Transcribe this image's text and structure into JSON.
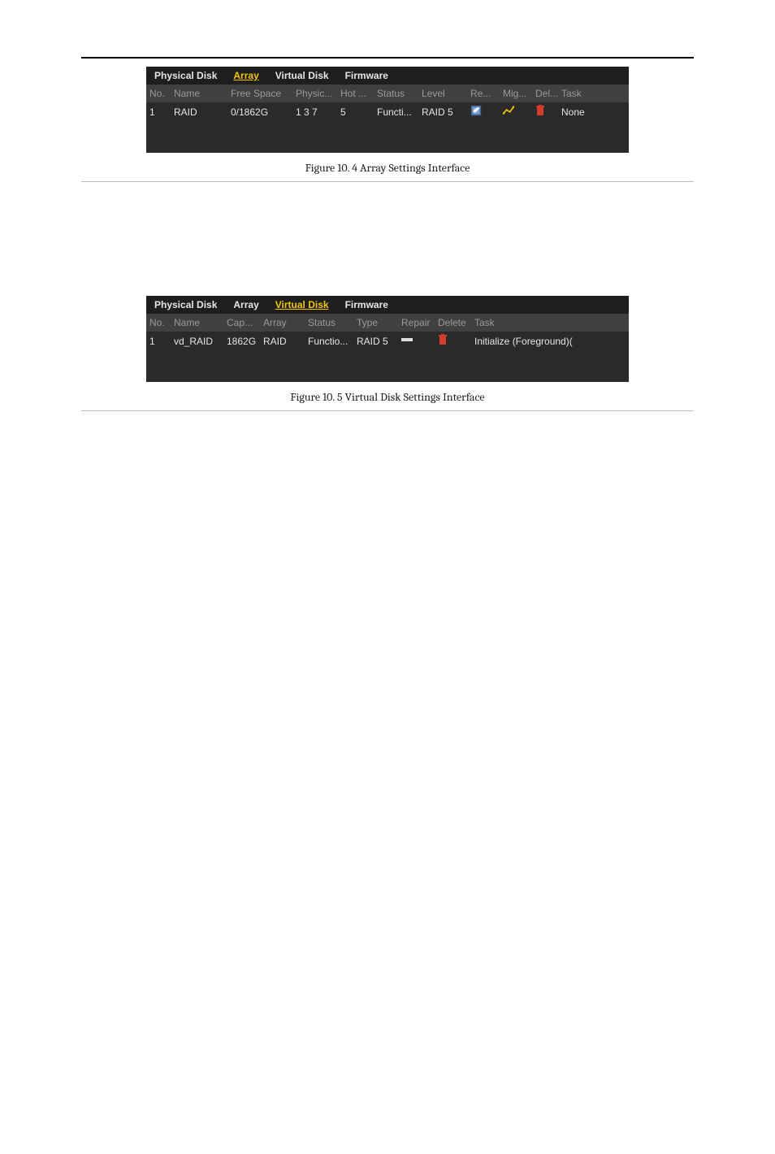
{
  "tabs": {
    "physical_disk": "Physical Disk",
    "array": "Array",
    "virtual_disk": "Virtual Disk",
    "firmware": "Firmware"
  },
  "array_table": {
    "headers": {
      "no": "No.",
      "name": "Name",
      "free_space": "Free Space",
      "physic": "Physic...",
      "hot": "Hot ...",
      "status": "Status",
      "level": "Level",
      "re": "Re...",
      "mig": "Mig...",
      "del": "Del...",
      "task": "Task"
    },
    "rows": [
      {
        "no": "1",
        "name": "RAID",
        "free_space": "0/1862G",
        "physic": "1 3 7",
        "hot": "5",
        "status": "Functi...",
        "level": "RAID 5",
        "task": "None"
      }
    ]
  },
  "vd_table": {
    "headers": {
      "no": "No.",
      "name": "Name",
      "cap": "Cap...",
      "array": "Array",
      "status": "Status",
      "type": "Type",
      "repair": "Repair",
      "delete": "Delete",
      "task": "Task"
    },
    "rows": [
      {
        "no": "1",
        "name": "vd_RAID",
        "cap": "1862G",
        "array": "RAID",
        "status": "Functio...",
        "type": "RAID 5",
        "task": "Initialize (Foreground)("
      }
    ]
  },
  "captions": {
    "fig1": "Figure 10. 4 Array Settings Interface",
    "fig2": "Figure 10. 5 Virtual Disk Settings Interface"
  }
}
